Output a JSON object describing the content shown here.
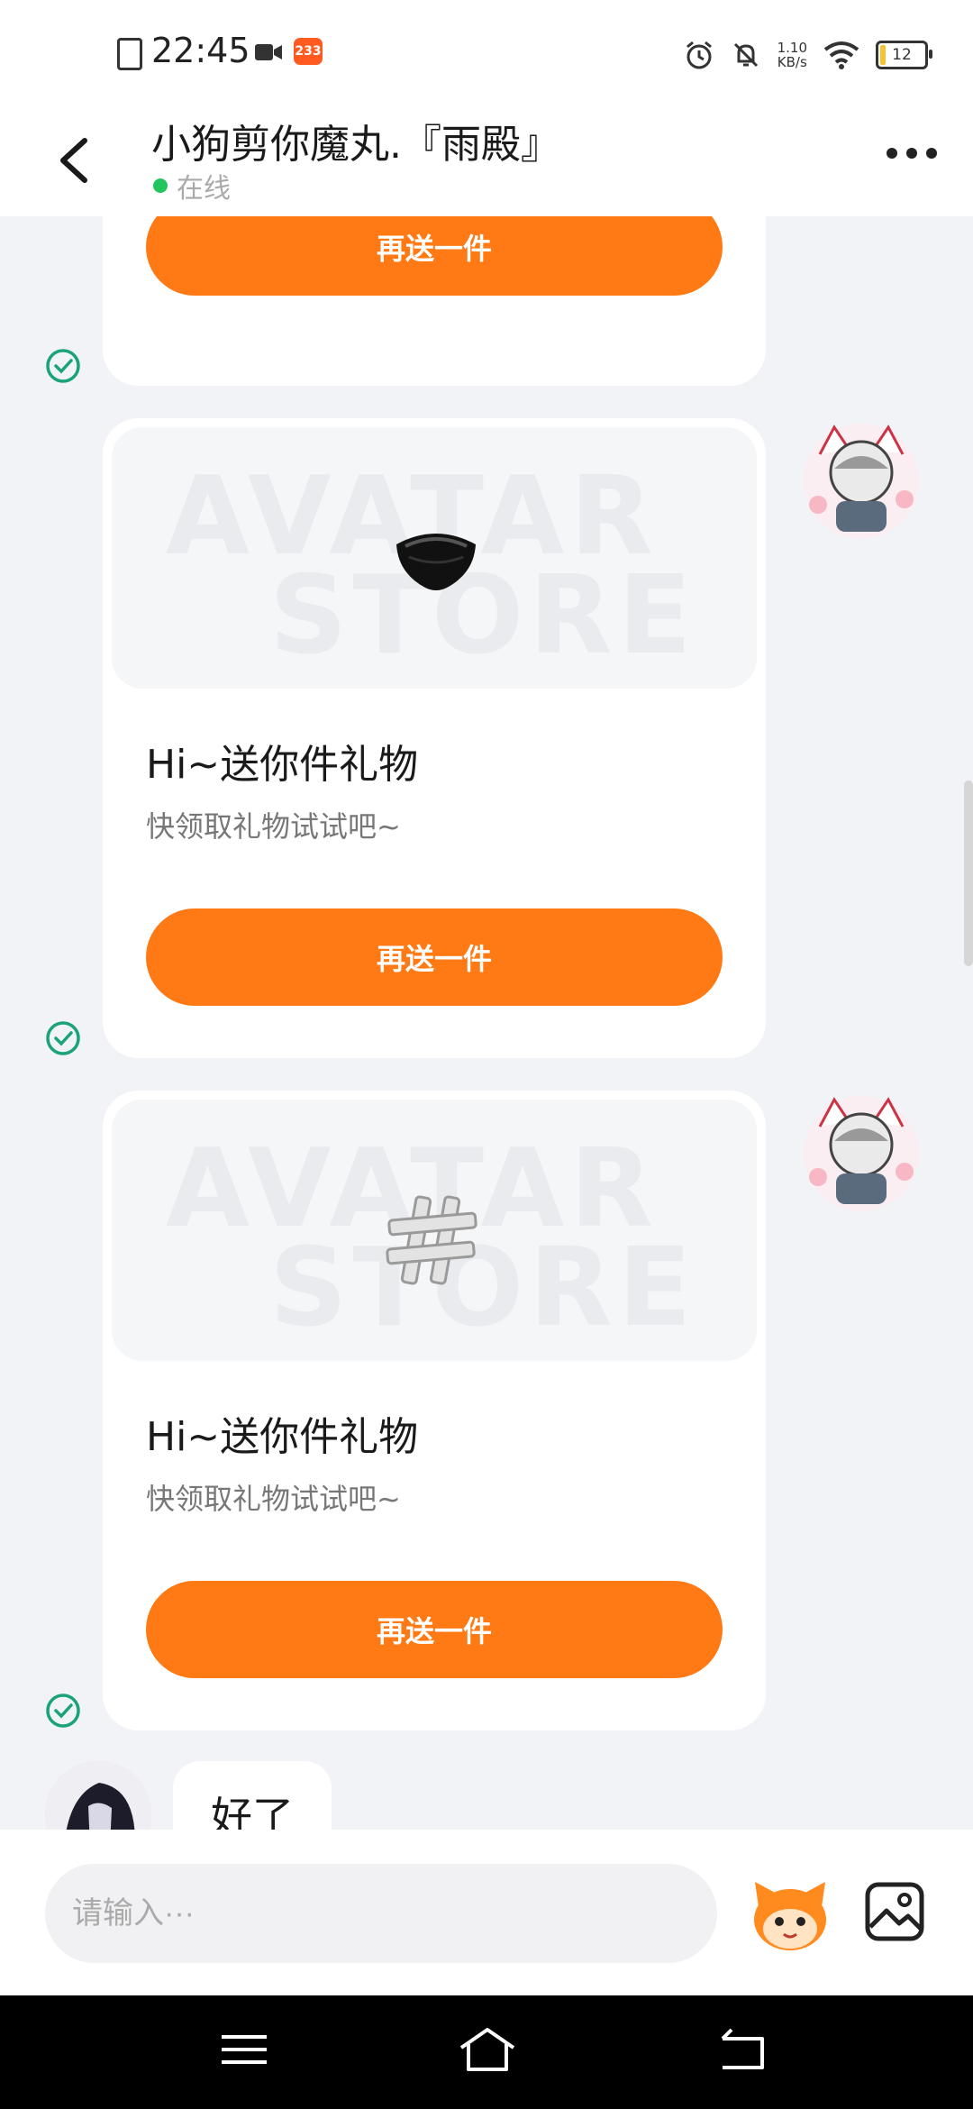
{
  "status_bar": {
    "time": "22:45",
    "badge_count": "233",
    "net_speed_value": "1.10",
    "net_speed_unit": "KB/s",
    "battery": "12"
  },
  "header": {
    "title": "小狗剪你魔丸.『雨殿』",
    "status": "在线",
    "status_color": "#22c55e"
  },
  "messages": {
    "gift_1": {
      "button": "再送一件"
    },
    "gift_2": {
      "title": "Hi~送你件礼物",
      "subtitle": "快领取礼物试试吧~",
      "button": "再送一件",
      "watermark_1": "AVATAR",
      "watermark_2": "STORE",
      "item_icon": "mask-icon"
    },
    "gift_3": {
      "title": "Hi~送你件礼物",
      "subtitle": "快领取礼物试试吧~",
      "button": "再送一件",
      "watermark_1": "AVATAR",
      "watermark_2": "STORE",
      "item_icon": "hash-icon"
    },
    "reply": {
      "text": "好了"
    }
  },
  "input_bar": {
    "placeholder": "请输入···"
  },
  "colors": {
    "accent": "#ff7a14",
    "check": "#1aa37a"
  }
}
